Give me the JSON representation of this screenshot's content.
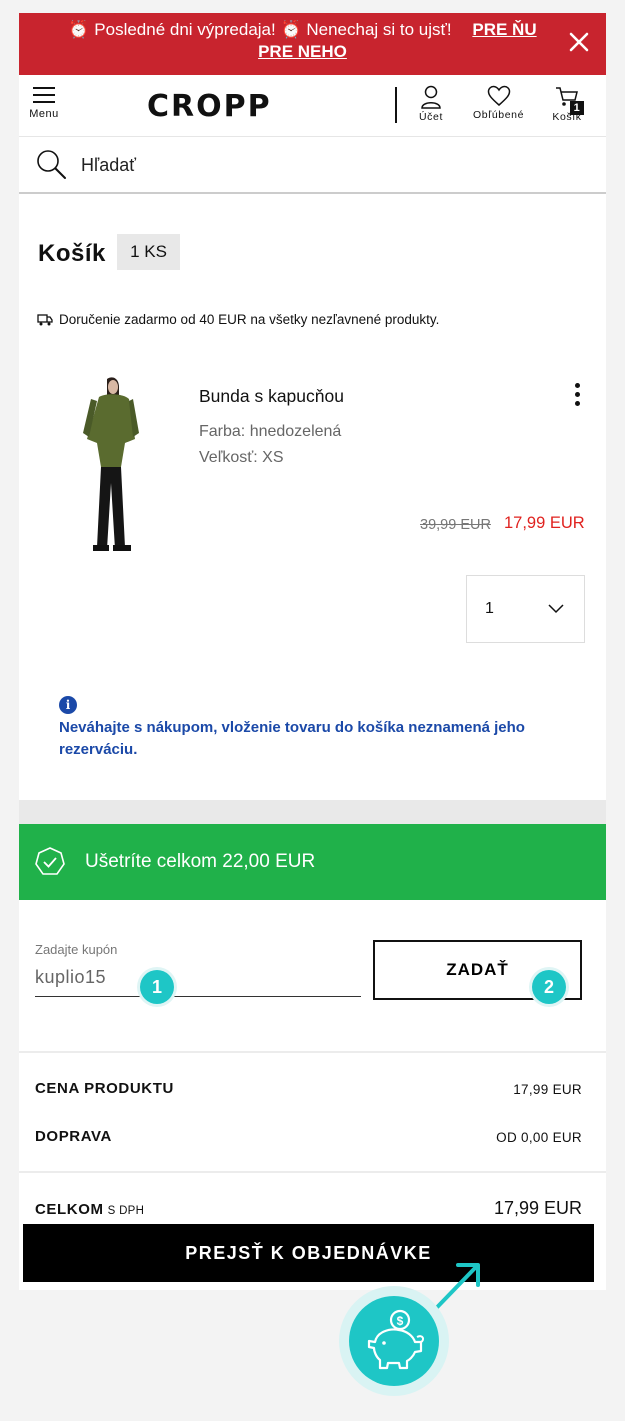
{
  "promo": {
    "message": "⏰ Posledné dni výpredaja! ⏰ Nenechaj si to ujsť!",
    "link_her": "PRE ŇU",
    "link_him": "PRE NEHO",
    "close_icon": "close-icon"
  },
  "header": {
    "menu_label": "Menu",
    "logo": "CROPP",
    "account_label": "Účet",
    "favorites_label": "Obľúbené",
    "cart_label": "Košík",
    "cart_count": "1"
  },
  "search": {
    "placeholder": "Hľadať"
  },
  "cart": {
    "title": "Košík",
    "count": "1 KS",
    "delivery_note": "Doručenie zadarmo od 40 EUR na všetky nezľavnené produkty."
  },
  "product": {
    "name": "Bunda s kapucňou",
    "color": "Farba: hnedozelená",
    "size": "Veľkosť: XS",
    "old_price": "39,99 EUR",
    "new_price": "17,99 EUR",
    "quantity": "1"
  },
  "info": {
    "text": "Neváhajte s nákupom, vloženie tovaru do košíka neznamená jeho rezerváciu."
  },
  "savings": {
    "text": "Ušetríte celkom 22,00 EUR",
    "color": "#20b14a"
  },
  "coupon": {
    "label": "Zadajte kupón",
    "value": "kuplio15",
    "button": "ZADAŤ",
    "step1": "1",
    "step2": "2"
  },
  "summary": {
    "product_label": "CENA PRODUKTU",
    "product_value": "17,99 EUR",
    "shipping_label": "DOPRAVA",
    "shipping_value": "OD 0,00 EUR",
    "total_label": "CELKOM",
    "total_suffix": "S DPH",
    "total_value": "17,99 EUR"
  },
  "checkout": {
    "button": "PREJSŤ K OBJEDNÁVKE"
  },
  "colors": {
    "promo": "#c8242e",
    "accent_teal": "#1ec6c6",
    "sale_red": "#e0221f",
    "info_blue": "#1b49a8"
  }
}
